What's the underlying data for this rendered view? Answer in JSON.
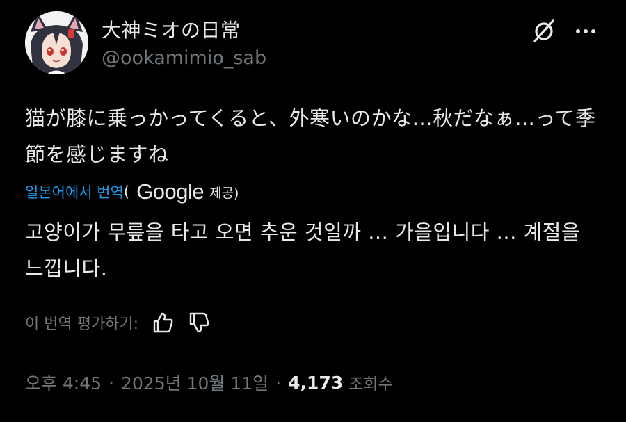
{
  "author": {
    "display_name": "大神ミオの日常",
    "handle": "@ookamimio_sab"
  },
  "icons": {
    "avatar": "anime-wolf-girl-avatar",
    "grok": "grok-icon",
    "more": "more-icon",
    "like": "thumbs-up-icon",
    "dislike": "thumbs-down-icon"
  },
  "post": {
    "text": "猫が膝に乗っかってくると、外寒いのかな…秋だなぁ…って季節を感じますね"
  },
  "translation": {
    "link_label": "일본어에서 번역",
    "paren_open": "(",
    "provider": "Google",
    "provided_label": "제공)",
    "text": "고양이가 무릎을 타고 오면 추운 것일까 ... 가을입니다 ... 계절을 느낍니다."
  },
  "rating": {
    "label": "이 번역 평가하기:"
  },
  "meta": {
    "time": "오후 4:45",
    "separator": "·",
    "date": "2025년 10월 11일",
    "views_count": "4,173",
    "views_label": "조회수"
  },
  "colors": {
    "background": "#000000",
    "primary_text": "#e7e9ea",
    "secondary_text": "#71767b",
    "link": "#1d9bf0"
  }
}
